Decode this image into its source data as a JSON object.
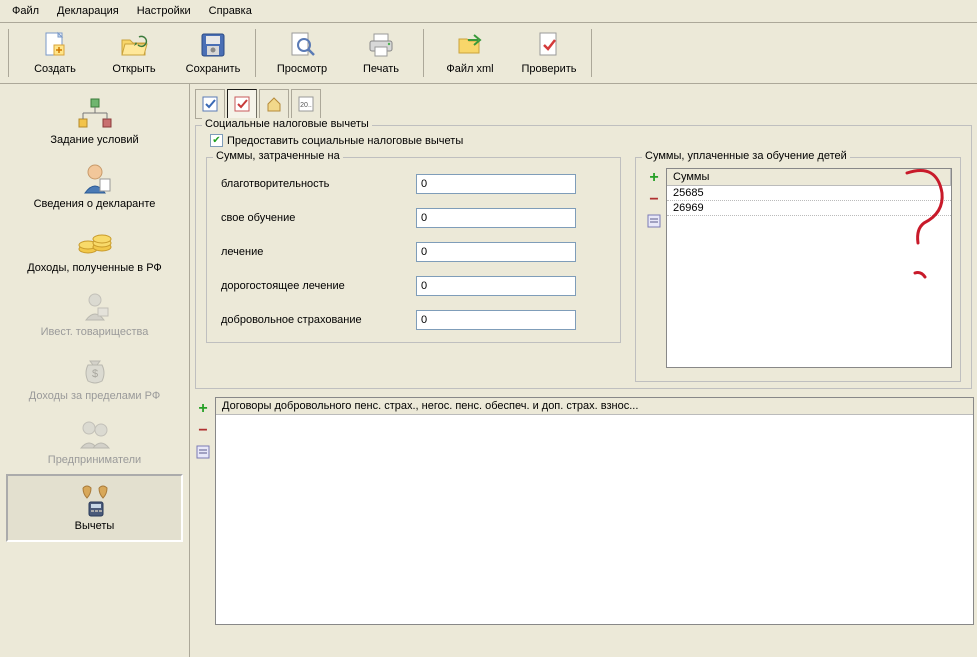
{
  "menu": {
    "items": [
      "Файл",
      "Декларация",
      "Настройки",
      "Справка"
    ]
  },
  "toolbar": {
    "create": "Создать",
    "open": "Открыть",
    "save": "Сохранить",
    "preview": "Просмотр",
    "print": "Печать",
    "filexml": "Файл xml",
    "check": "Проверить"
  },
  "sidebar": {
    "items": [
      {
        "label": "Задание условий"
      },
      {
        "label": "Сведения о декларанте"
      },
      {
        "label": "Доходы, полученные в РФ"
      },
      {
        "label": "Ивест. товарищества"
      },
      {
        "label": "Доходы за пределами РФ"
      },
      {
        "label": "Предприниматели"
      },
      {
        "label": "Вычеты"
      }
    ]
  },
  "social": {
    "group_title": "Социальные налоговые вычеты",
    "checkbox_label": "Предоставить социальные налоговые вычеты"
  },
  "sums": {
    "group_title": "Суммы, затраченные на",
    "rows": {
      "charity": {
        "label": "благотворительность",
        "value": "0"
      },
      "own_edu": {
        "label": "свое обучение",
        "value": "0"
      },
      "treatment": {
        "label": "лечение",
        "value": "0"
      },
      "exp_treatment": {
        "label": "дорогостоящее лечение",
        "value": "0"
      },
      "insurance": {
        "label": "добровольное страхование",
        "value": "0"
      }
    }
  },
  "children": {
    "group_title": "Суммы, уплаченные за обучение детей",
    "header": "Суммы",
    "rows": [
      "25685",
      "26969"
    ]
  },
  "contracts": {
    "header": "Договоры добровольного пенс. страх., негос. пенс. обеспеч. и доп. страх. взнос..."
  },
  "mini_toolbar": {
    "tab_label": "20.."
  }
}
